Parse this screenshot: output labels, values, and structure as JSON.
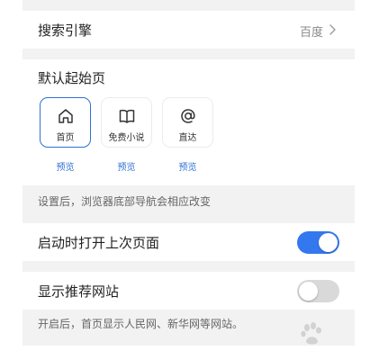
{
  "search_engine": {
    "label": "搜索引擎",
    "value": "百度"
  },
  "default_homepage": {
    "title": "默认起始页",
    "options": [
      {
        "name": "首页",
        "icon": "home-icon",
        "selected": true,
        "preview": "预览"
      },
      {
        "name": "免费小说",
        "icon": "book-icon",
        "selected": false,
        "preview": "预览"
      },
      {
        "name": "直达",
        "icon": "at-sign-icon",
        "selected": false,
        "preview": "预览"
      }
    ],
    "hint": "设置后，浏览器底部导航会相应改变"
  },
  "restore_last_page": {
    "label": "启动时打开上次页面",
    "enabled": true
  },
  "recommended_sites": {
    "label": "显示推荐网站",
    "enabled": false,
    "hint": "开启后，首页显示人民网、新华网等网站。"
  },
  "colors": {
    "accent": "#3478f0",
    "link": "#2f6fd6",
    "background": "#f2f2f2"
  }
}
